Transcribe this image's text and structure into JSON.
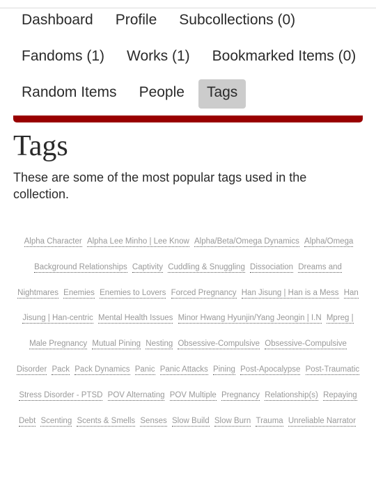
{
  "nav": {
    "items": [
      {
        "label": "Dashboard",
        "active": false
      },
      {
        "label": "Profile",
        "active": false
      },
      {
        "label": "Subcollections (0)",
        "active": false
      },
      {
        "label": "Fandoms (1)",
        "active": false
      },
      {
        "label": "Works (1)",
        "active": false
      },
      {
        "label": "Bookmarked Items (0)",
        "active": false
      },
      {
        "label": "Random Items",
        "active": false
      },
      {
        "label": "People",
        "active": false
      },
      {
        "label": "Tags",
        "active": true
      }
    ]
  },
  "colors": {
    "accent_bar": "#990000",
    "active_tab": "#cccccc",
    "tag_text": "#999999"
  },
  "main": {
    "title": "Tags",
    "intro": "These are some of the most popular tags used in the collection."
  },
  "tags": [
    "Alpha Character",
    "Alpha Lee Minho | Lee Know",
    "Alpha/Beta/Omega Dynamics",
    "Alpha/Omega Background Relationships",
    "Captivity",
    "Cuddling & Snuggling",
    "Dissociation",
    "Dreams and Nightmares",
    "Enemies",
    "Enemies to Lovers",
    "Forced Pregnancy",
    "Han Jisung | Han is a Mess",
    "Han Jisung | Han-centric",
    "Mental Health Issues",
    "Minor Hwang Hyunjin/Yang Jeongin | I.N",
    "Mpreg | Male Pregnancy",
    "Mutual Pining",
    "Nesting",
    "Obsessive-Compulsive",
    "Obsessive-Compulsive Disorder",
    "Pack",
    "Pack Dynamics",
    "Panic",
    "Panic Attacks",
    "Pining",
    "Post-Apocalypse",
    "Post-Traumatic Stress Disorder - PTSD",
    "POV Alternating",
    "POV Multiple",
    "Pregnancy",
    "Relationship(s)",
    "Repaying Debt",
    "Scenting",
    "Scents & Smells",
    "Senses",
    "Slow Build",
    "Slow Burn",
    "Trauma",
    "Unreliable Narrator"
  ]
}
